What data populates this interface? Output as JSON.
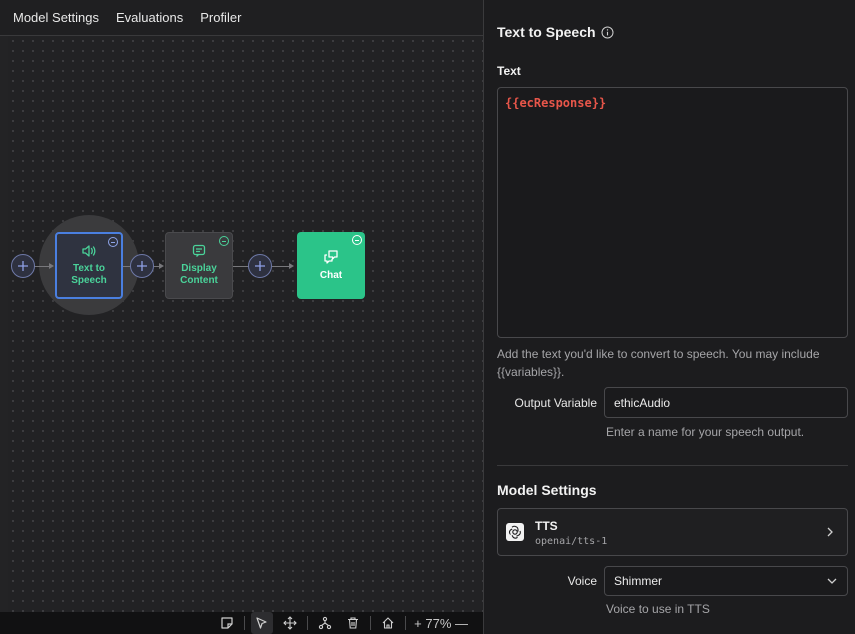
{
  "tabs": [
    "Model Settings",
    "Evaluations",
    "Profiler"
  ],
  "canvas": {
    "nodes": {
      "tts": {
        "label_line1": "Text to",
        "label_line2": "Speech",
        "icon": "speaker-icon",
        "color": "#4ad39a"
      },
      "display": {
        "label_line1": "Display",
        "label_line2": "Content",
        "icon": "message-square-icon",
        "color": "#4ad39a"
      },
      "chat": {
        "label": "Chat",
        "icon": "chat-bubbles-icon",
        "color": "#2bc489"
      }
    },
    "zoom": "77%"
  },
  "toolbar": {
    "zoom_text": "+ 77% —",
    "icons": [
      "sticky-note-icon",
      "pointer-icon",
      "move-icon",
      "connections-icon",
      "trash-icon",
      "home-icon",
      "zoom-in-icon",
      "zoom-out-icon"
    ]
  },
  "panel": {
    "title": "Text to Speech",
    "text_label": "Text",
    "text_value": "{{ecResponse}}",
    "help": "Add the text you'd like to convert to speech. You may include {{variables}}.",
    "output_label": "Output Variable",
    "output_value": "ethicAudio",
    "output_hint": "Enter a name for your speech output.",
    "model_settings_header": "Model Settings",
    "model": {
      "name": "TTS",
      "id": "openai/tts-1",
      "icon": "openai-logo-icon"
    },
    "voice_label": "Voice",
    "voice_value": "Shimmer",
    "voice_hint": "Voice to use in TTS"
  },
  "colors": {
    "accent_blue": "#4a7fe0",
    "green": "#2bc489",
    "error_red": "#e8564a"
  }
}
